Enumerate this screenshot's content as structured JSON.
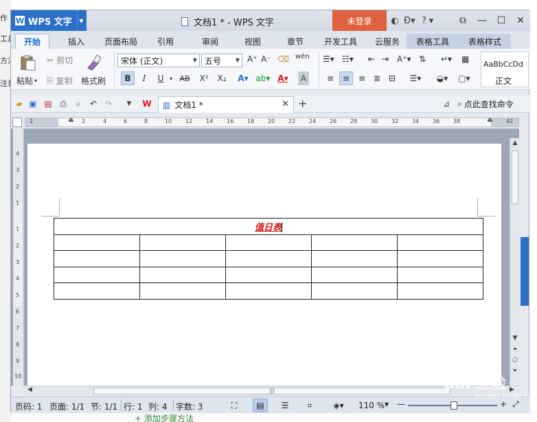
{
  "background": {
    "left_fragments": [
      "作",
      "工具",
      "方法",
      "注意"
    ],
    "bottom_fragment": "+ 添加步骤方法"
  },
  "titlebar": {
    "app_name": "WPS 文字",
    "app_logo": "W",
    "window_title": "文档1 * - WPS 文字",
    "login_label": "未登录",
    "icons": [
      "skin-icon",
      "theme-icon",
      "help-icon"
    ],
    "help_glyph": "?",
    "controls": [
      "restore-icon",
      "minimize-icon",
      "maximize-icon",
      "close-icon"
    ]
  },
  "tabs": [
    "开始",
    "插入",
    "页面布局",
    "引用",
    "审阅",
    "视图",
    "章节",
    "开发工具",
    "云服务",
    "表格工具",
    "表格样式"
  ],
  "ribbon": {
    "paste_label": "粘贴",
    "cut_label": "剪切",
    "copy_label": "复制",
    "format_painter_label": "格式刷",
    "font_name": "宋体 (正文)",
    "font_size": "五号",
    "bold": "B",
    "italic": "I",
    "underline": "U",
    "strike": "AB",
    "superscript": "X²",
    "subscript": "X₂",
    "style_sample": "AaBbCcDd",
    "style_name": "正文"
  },
  "quickbar": {
    "doc_tab_label": "文档1 *",
    "find_label": "点此查找命令"
  },
  "ruler": {
    "h_numbers": [
      "2",
      "2",
      "4",
      "6",
      "8",
      "10",
      "12",
      "14",
      "16",
      "18",
      "20",
      "22",
      "24",
      "26",
      "28",
      "30",
      "32",
      "34",
      "36",
      "38",
      "42"
    ],
    "v_numbers": [
      "4",
      "3",
      "2",
      "1",
      "1",
      "2",
      "3",
      "4",
      "5",
      "6",
      "7",
      "8",
      "9",
      "10"
    ]
  },
  "document": {
    "table_title": "值日表",
    "rows": 4,
    "cols": 5
  },
  "status": {
    "page_code": "页码: 1",
    "page": "页面: 1/1",
    "section": "节: 1/1",
    "row": "行: 1",
    "col": "列: 4",
    "words": "字数: 3",
    "zoom": "110 %"
  },
  "watermark": {
    "brand": "Bai 经验",
    "url": "jingyan.baidu.com"
  },
  "colors": {
    "accent": "#2b6fc9",
    "login": "#e0613f",
    "title_text": "#d61515"
  }
}
